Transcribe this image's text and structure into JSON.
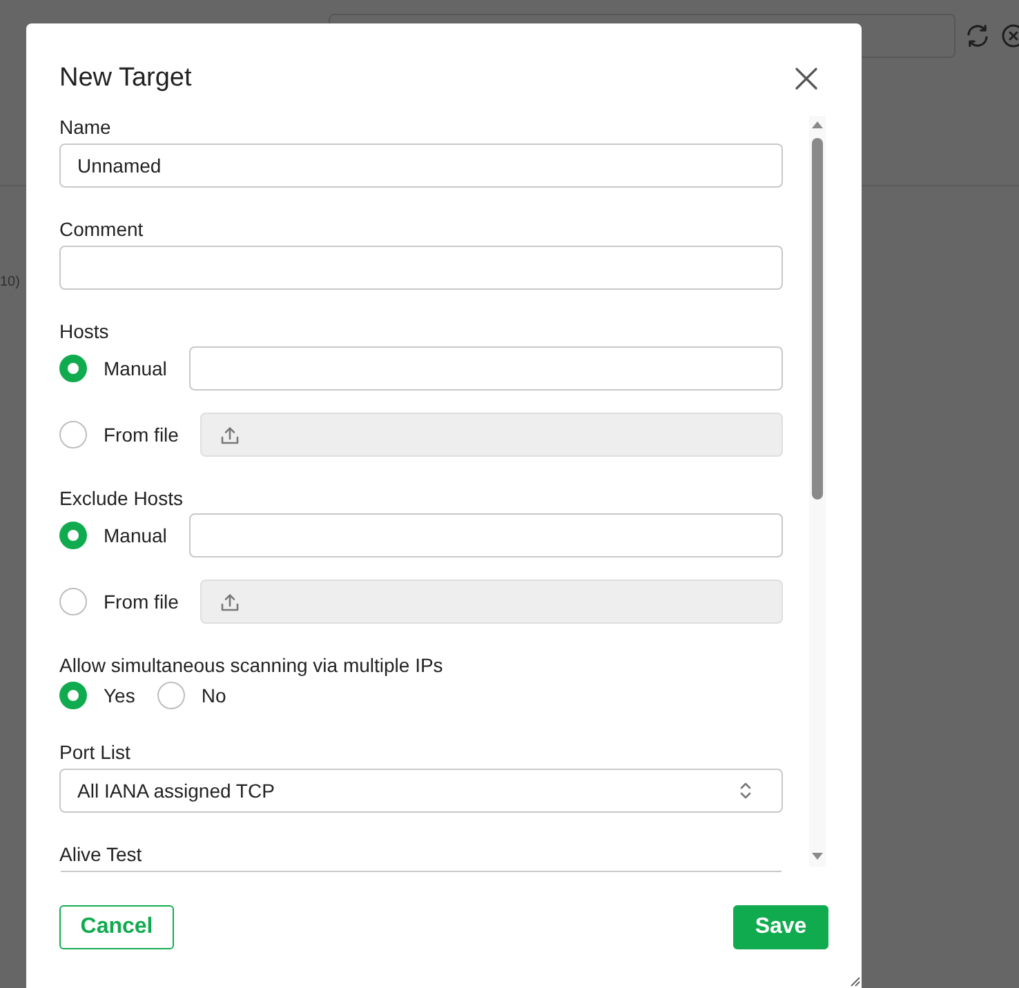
{
  "page": {
    "side_text": "10)"
  },
  "dialog": {
    "title": "New Target",
    "fields": [
      {
        "kind": "text",
        "label": "Name",
        "value": "Unnamed"
      },
      {
        "kind": "text",
        "label": "Comment"
      },
      {
        "kind": "source",
        "label": "Hosts",
        "options": [
          {
            "label": "Manual",
            "selected": true,
            "kind": "text"
          },
          {
            "label": "From file",
            "selected": false,
            "kind": "file"
          }
        ]
      },
      {
        "kind": "source",
        "label": "Exclude Hosts",
        "options": [
          {
            "label": "Manual",
            "selected": true,
            "kind": "text"
          },
          {
            "label": "From file",
            "selected": false,
            "kind": "file"
          }
        ]
      },
      {
        "kind": "radio",
        "label": "Allow simultaneous scanning via multiple IPs",
        "options": [
          {
            "label": "Yes",
            "selected": true
          },
          {
            "label": "No",
            "selected": false
          }
        ]
      },
      {
        "kind": "select",
        "label": "Port List",
        "value": "All IANA assigned TCP"
      },
      {
        "kind": "select",
        "label": "Alive Test",
        "cut": true
      }
    ],
    "buttons": [
      {
        "label": "Cancel",
        "kind": "secondary"
      },
      {
        "label": "Save",
        "kind": "primary"
      }
    ]
  }
}
